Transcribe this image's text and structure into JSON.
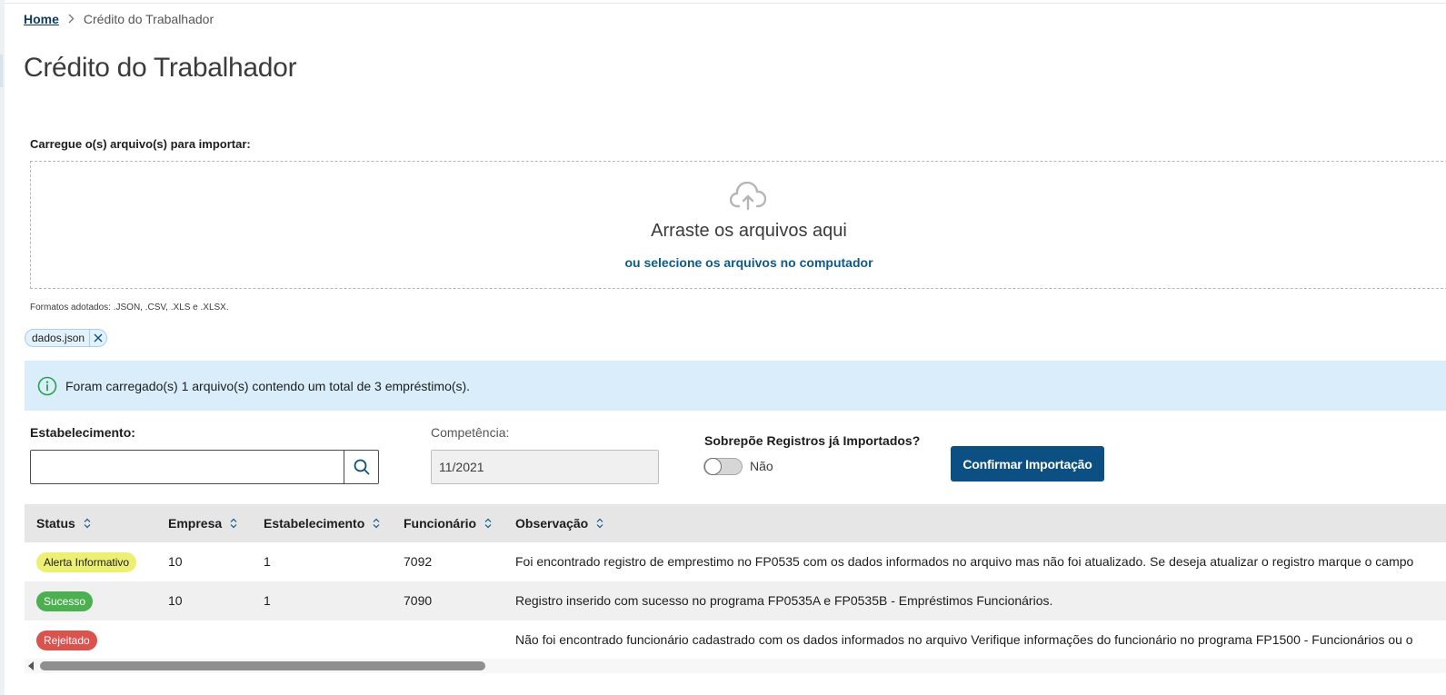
{
  "breadcrumb": {
    "home": "Home",
    "current": "Crédito do Trabalhador"
  },
  "page": {
    "title": "Crédito do Trabalhador"
  },
  "upload": {
    "label": "Carregue o(s) arquivo(s) para importar:",
    "drop_title": "Arraste os arquivos aqui",
    "select_link": "ou selecione os arquivos no computador",
    "formats": "Formatos adotados: .JSON, .CSV, .XLS e .XLSX."
  },
  "files": [
    {
      "name": "dados.json"
    }
  ],
  "banner": {
    "text": "Foram carregado(s) 1 arquivo(s) contendo um total de 3 empréstimo(s)."
  },
  "form": {
    "estabelecimento_label": "Estabelecimento:",
    "estabelecimento_value": "",
    "competencia_label": "Competência:",
    "competencia_value": "11/2021",
    "sobrepoe_label": "Sobrepõe Registros já Importados?",
    "sobrepoe_value": "Não",
    "confirm_label": "Confirmar Importação"
  },
  "table": {
    "columns": [
      "Status",
      "Empresa",
      "Estabelecimento",
      "Funcionário",
      "Observação"
    ],
    "rows": [
      {
        "status": "Alerta Informativo",
        "status_kind": "warning",
        "empresa": "10",
        "estabelecimento": "1",
        "funcionario": "7092",
        "observacao": "Foi encontrado registro de emprestimo no FP0535 com os dados informados no arquivo mas não foi atualizado. Se deseja atualizar o registro marque o campo"
      },
      {
        "status": "Sucesso",
        "status_kind": "success",
        "empresa": "10",
        "estabelecimento": "1",
        "funcionario": "7090",
        "observacao": "Registro inserido com sucesso no programa FP0535A e FP0535B - Empréstimos Funcionários."
      },
      {
        "status": "Rejeitado",
        "status_kind": "rejected",
        "empresa": "",
        "estabelecimento": "",
        "funcionario": "",
        "observacao": "Não foi encontrado funcionário cadastrado com os dados informados no arquivo Verifique informações do funcionário no programa FP1500 - Funcionários ou o"
      }
    ]
  },
  "icons": {
    "upload": "cloud-upload-icon",
    "info": "info-icon",
    "search": "search-icon",
    "close": "close-icon",
    "sort": "sort-icon",
    "breadcrumb_separator": "chevron-right-icon"
  },
  "colors": {
    "primary": "#0c4f82",
    "link": "#0c5a8a",
    "banner_bg": "#d9eefa",
    "info_icon": "#2e9e4f",
    "warning": "#ecef72",
    "success": "#4caf50",
    "rejected": "#d9534f",
    "table_header": "#e6e6e6"
  }
}
